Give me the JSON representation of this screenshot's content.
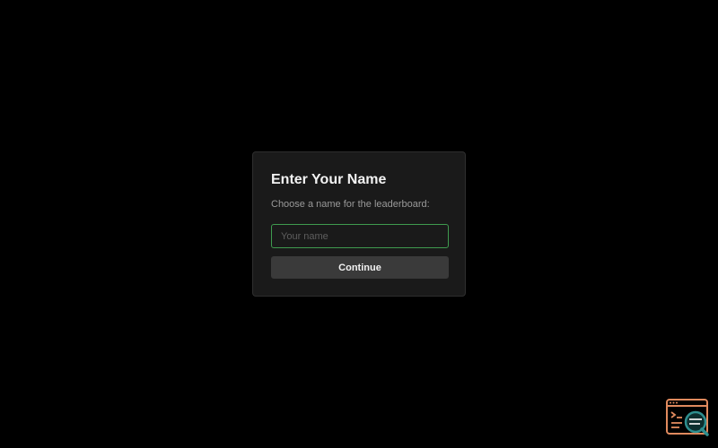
{
  "dialog": {
    "title": "Enter Your Name",
    "subtitle": "Choose a name for the leaderboard:",
    "input_placeholder": "Your name",
    "input_value": "",
    "continue_label": "Continue"
  },
  "colors": {
    "background": "#000000",
    "dialog_background": "#1a1a1a",
    "input_focus_border": "#3f9a4f",
    "button_background": "#3a3a3a",
    "widget_accent": "#e08a5e",
    "widget_teal": "#2f8f8f"
  },
  "icons": {
    "corner_widget": "browser-terminal-inspect-icon"
  }
}
